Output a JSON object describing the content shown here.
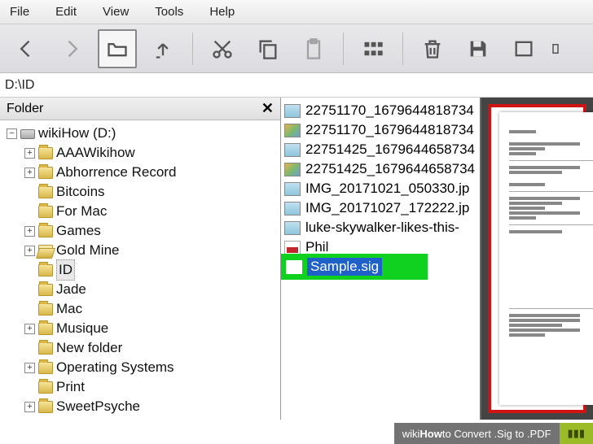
{
  "menu": {
    "file": "File",
    "edit": "Edit",
    "view": "View",
    "tools": "Tools",
    "help": "Help"
  },
  "path": "D:\\ID",
  "tree": {
    "header": "Folder",
    "root": "wikiHow (D:)",
    "items": [
      {
        "label": "AAAWikihow",
        "exp": "+",
        "open": false
      },
      {
        "label": "Abhorrence Record",
        "exp": "+",
        "open": false
      },
      {
        "label": "Bitcoins",
        "exp": "",
        "open": false
      },
      {
        "label": "For Mac",
        "exp": "",
        "open": false
      },
      {
        "label": "Games",
        "exp": "+",
        "open": false
      },
      {
        "label": "Gold Mine",
        "exp": "+",
        "open": true
      },
      {
        "label": "ID",
        "exp": "",
        "open": false,
        "sel": true
      },
      {
        "label": "Jade",
        "exp": "",
        "open": false
      },
      {
        "label": "Mac",
        "exp": "",
        "open": false
      },
      {
        "label": "Musique",
        "exp": "+",
        "open": false
      },
      {
        "label": "New folder",
        "exp": "",
        "open": false
      },
      {
        "label": "Operating Systems",
        "exp": "+",
        "open": false
      },
      {
        "label": "Print",
        "exp": "",
        "open": false
      },
      {
        "label": "SweetPsyche",
        "exp": "+",
        "open": false
      }
    ]
  },
  "files": [
    {
      "name": "22751170_1679644818734",
      "t": "img"
    },
    {
      "name": "22751170_1679644818734",
      "t": "col"
    },
    {
      "name": "22751425_1679644658734",
      "t": "img"
    },
    {
      "name": "22751425_1679644658734",
      "t": "col"
    },
    {
      "name": "IMG_20171021_050330.jp",
      "t": "img"
    },
    {
      "name": "IMG_20171027_172222.jp",
      "t": "img"
    },
    {
      "name": "luke-skywalker-likes-this-",
      "t": "img"
    },
    {
      "name": "Phil",
      "t": "pdf"
    }
  ],
  "selected_file": "Sample.sig",
  "watermark": {
    "brand_pre": "wiki",
    "brand_bold": "How",
    "tail": " to Convert .Sig to .PDF"
  }
}
